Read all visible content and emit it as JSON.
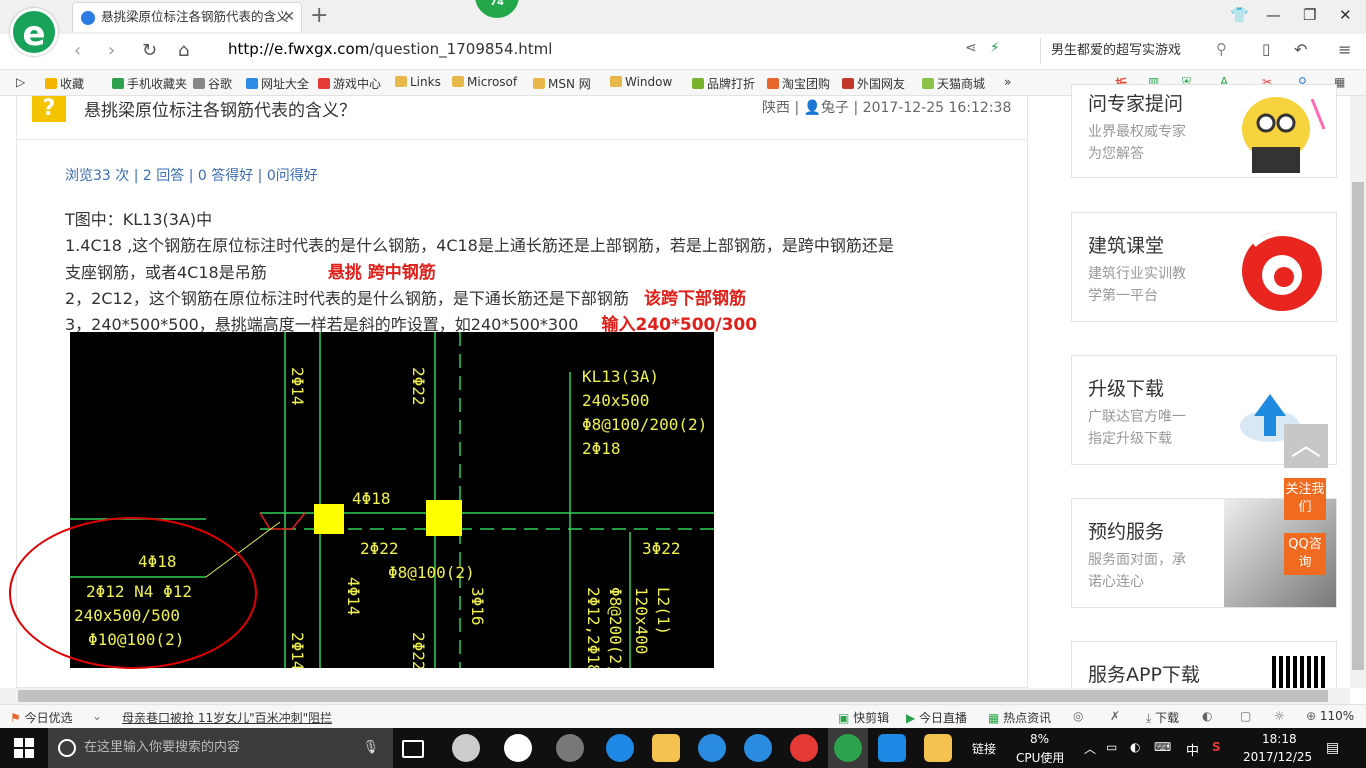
{
  "browser": {
    "tab_title": "悬挑梁原位标注各钢筋代表的含义",
    "badge": "74",
    "url_host": "http://e.fwxgx.com",
    "url_path": "/question_1709854.html",
    "site_search": "男生都爱的超写实游戏",
    "bookmarks": [
      "收藏",
      "手机收藏夹",
      "谷歌",
      "网址大全",
      "游戏中心",
      "Links",
      "Microsof",
      "MSN 网",
      "Window",
      "品牌打折",
      "淘宝团购",
      "外国网友",
      "天猫商城"
    ],
    "bookmark_colors": [
      "#f5b400",
      "#2ca24c",
      "#888",
      "#2c8be5",
      "#e53935",
      "#e8b84a",
      "#e8b84a",
      "#e8b84a",
      "#e8b84a",
      "#79b32e",
      "#e8662c",
      "#c0392b",
      "#8bc34a"
    ]
  },
  "question": {
    "title": "悬挑梁原位标注各钢筋代表的含义？",
    "meta": "陕西 | 👤兔子 | 2017-12-25 16:12:38",
    "stats": "浏览33 次 | 2 回答 | 0 答得好 | 0问得好",
    "line0": "T图中：KL13(3A)中",
    "line1": "1.4C18 ,这个钢筋在原位标注时代表的是什么钢筋，4C18是上通长筋还是上部钢筋，若是上部钢筋，是跨中钢筋还是",
    "line2": "支座钢筋，或者4C18是吊筋",
    "answer1": "悬挑 跨中钢筋",
    "line3": " 2，2C12，这个钢筋在原位标注时代表的是什么钢筋，是下通长筋还是下部钢筋",
    "answer2": "该跨下部钢筋",
    "line4": " 3，240*500*500，悬挑端高度一样若是斜的咋设置，如240*500*300",
    "answer3": "输入240*500/300"
  },
  "drawing": {
    "v1": "2Φ14",
    "v2": "2Φ22",
    "kl_title": "KL13(3A)",
    "kl_size": "240x500",
    "kl_stirrup": "Φ8@100/200(2)",
    "kl_top": "2Φ18",
    "top_bar": "4Φ18",
    "mid_a": "2Φ22",
    "mid_b": "Φ8@100(2)",
    "right": "3Φ22",
    "c1": "4Φ18",
    "c2": "2Φ12 N4 Φ12",
    "c3": "240x500/500",
    "c4": "Φ10@100(2)",
    "vb1": "4Φ14",
    "vb2": "3Φ16",
    "vb3": "2Φ12,2Φ18",
    "vb4": "Φ8@200(2)",
    "vb5": "120x400",
    "vb6": "L2(1)",
    "vb7": "2Φ14",
    "vb8": "2Φ22"
  },
  "sidebar": {
    "card0_title": "问专家提问",
    "card0_l1": "业界最权威专家",
    "card0_l2": "为您解答",
    "card1_title": "建筑课堂",
    "card1_l1": "建筑行业实训教",
    "card1_l2": "学第一平台",
    "card2_title": "升级下载",
    "card2_l1": "广联达官方唯一",
    "card2_l2": "指定升级下载",
    "card3_title": "预约服务",
    "card3_l1": "服务面对面，承",
    "card3_l2": "诺心连心",
    "card4_title": "服务APP下载",
    "follow": "关注我们",
    "qq": "QQ咨询"
  },
  "status": {
    "left1": "今日优选",
    "news": "母亲巷口被抢 11岁女儿\"百米冲刺\"阻拦",
    "r1": "快剪辑",
    "r2": "今日直播",
    "r3": "热点资讯",
    "r4": "下载",
    "zoom": "110%"
  },
  "taskbar": {
    "search": "在这里输入你要搜索的内容",
    "link": "链接",
    "cpu_pct": "8%",
    "cpu": "CPU使用",
    "ime": "中",
    "time": "18:18",
    "date": "2017/12/25"
  }
}
